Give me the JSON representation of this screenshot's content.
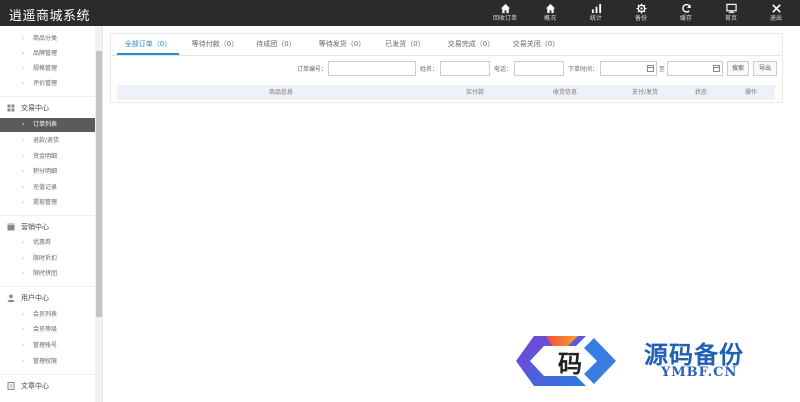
{
  "app": {
    "title": "逍遥商城系统"
  },
  "header": {
    "buttons": [
      {
        "label": "回收订单",
        "icon": "home-icon"
      },
      {
        "label": "概况",
        "icon": "home-icon"
      },
      {
        "label": "统计",
        "icon": "bar-chart-icon"
      },
      {
        "label": "备份",
        "icon": "gear-icon"
      },
      {
        "label": "缓存",
        "icon": "refresh-icon"
      },
      {
        "label": "首页",
        "icon": "monitor-icon"
      },
      {
        "label": "退出",
        "icon": "close-icon"
      }
    ]
  },
  "sidebar": {
    "items_top": [
      "商品分类",
      "品牌管理",
      "规格管理",
      "评价管理"
    ],
    "groups": [
      {
        "label": "交易中心",
        "icon": "trade-icon",
        "items": [
          "订单列表",
          "退款/退货",
          "资金明细",
          "积分明细",
          "充值记录",
          "提现管理"
        ]
      },
      {
        "label": "营销中心",
        "icon": "marketing-icon",
        "items": [
          "优惠券",
          "限时折扣",
          "限时拼团"
        ]
      },
      {
        "label": "用户中心",
        "icon": "user-icon",
        "items": [
          "会员列表",
          "会员等级",
          "管理帐号",
          "管理权限"
        ]
      },
      {
        "label": "文章中心",
        "icon": "article-icon",
        "items": []
      }
    ],
    "active_item": "订单列表"
  },
  "tabs": [
    "全部订单（0）",
    "等待付款（0）",
    "待成团（0）",
    "等待发货（0）",
    "已发货（0）",
    "交易完成（0）",
    "交易关闭（0）"
  ],
  "filter": {
    "order_no_label": "订单编号：",
    "name_label": "姓名：",
    "phone_label": "电话：",
    "order_time_label": "下单时间：",
    "to_label": "至",
    "search_button": "搜索",
    "export_button": "导出"
  },
  "table": {
    "headers": [
      "商品信息",
      "实付款",
      "收货信息",
      "支付/发货",
      "状态",
      "操作"
    ]
  },
  "watermark": {
    "logo_char": "码",
    "cn_text": "源码备份",
    "en_text": "YMBF.CN"
  },
  "colors": {
    "header_bg": "#2b2b2b",
    "accent": "#2a8fc7",
    "active_sidebar_bg": "#5b5b5b",
    "table_header_bg": "#eef1f8"
  }
}
